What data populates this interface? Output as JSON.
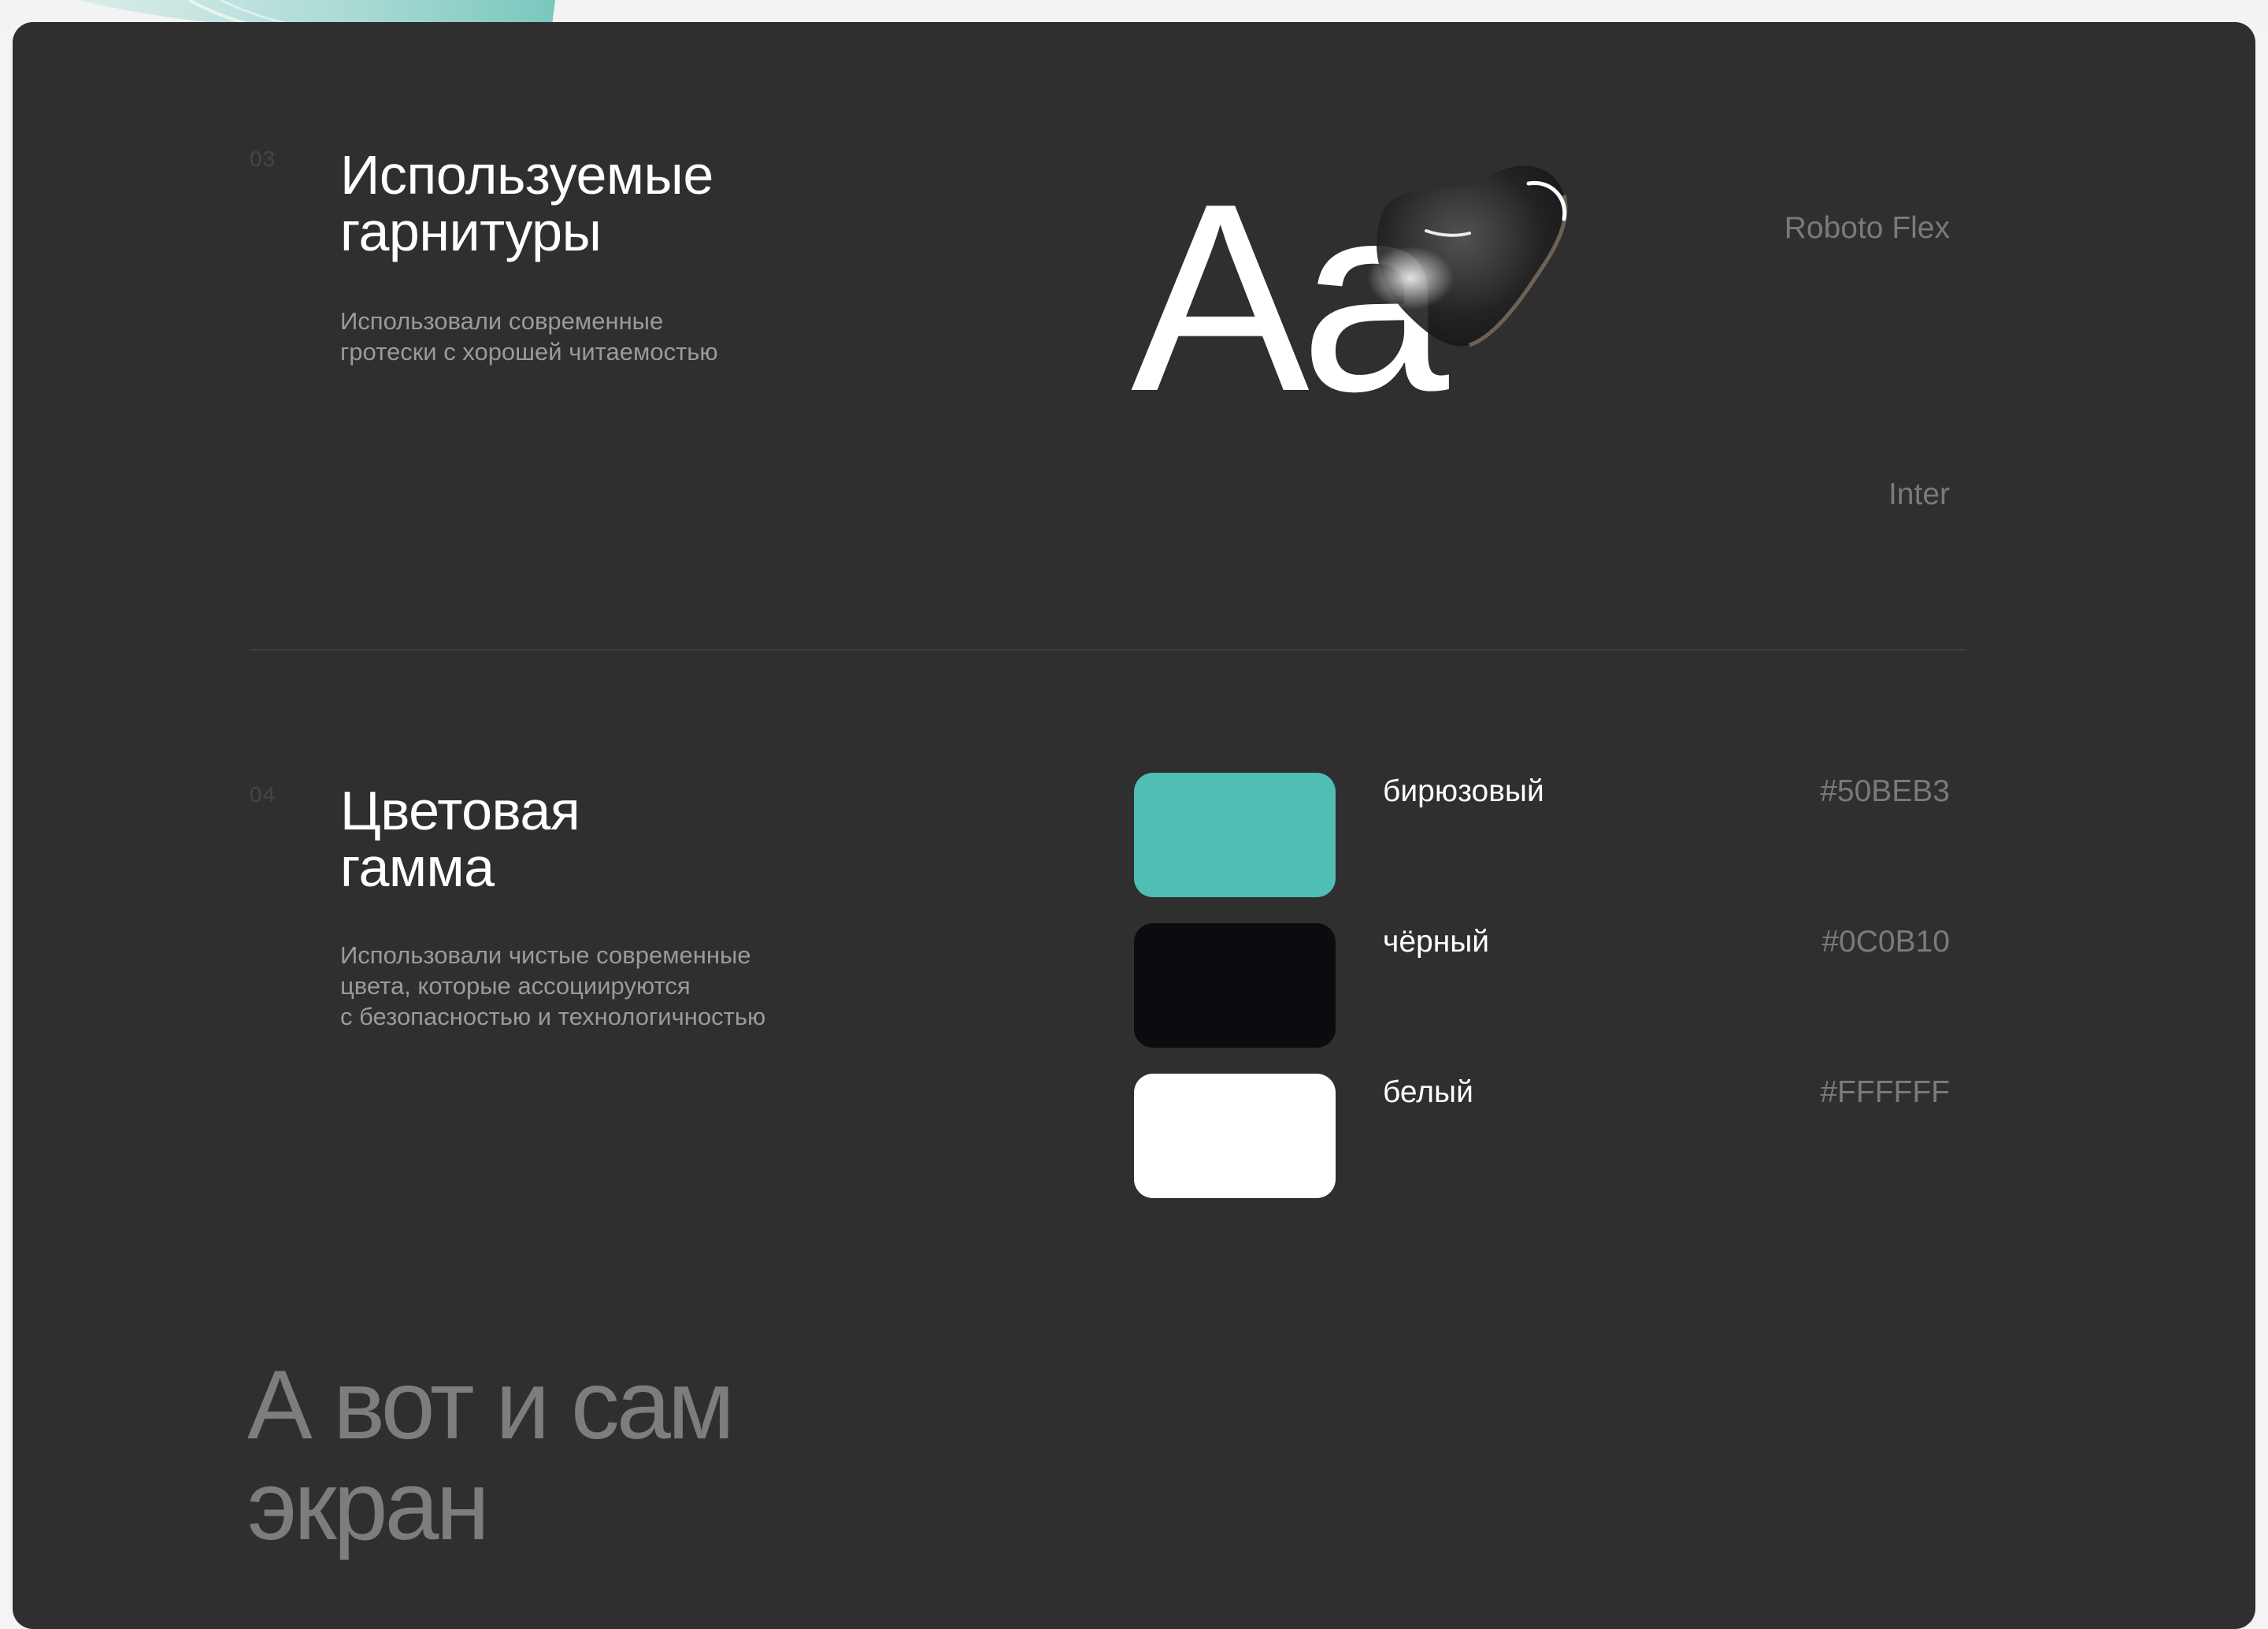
{
  "fonts_section": {
    "number": "03",
    "title_line1": "Используемые",
    "title_line2": "гарнитуры",
    "desc_line1": "Использовали современные",
    "desc_line2": "гротески с хорошей читаемостью",
    "sample": "Aa",
    "fonts": [
      "Roboto Flex",
      "Inter"
    ]
  },
  "colors_section": {
    "number": "04",
    "title_line1": "Цветовая",
    "title_line2": "гамма",
    "desc_line1": "Использовали чистые современные",
    "desc_line2": "цвета, которые ассоциируются",
    "desc_line3": "с безопасностью и технологичностью",
    "colors": [
      {
        "name": "бирюзовый",
        "hex": "#50BEB3",
        "swatch": "#50beb3"
      },
      {
        "name": "чёрный",
        "hex": "#0C0B10",
        "swatch": "#0c0b10"
      },
      {
        "name": "белый",
        "hex": "#FFFFFF",
        "swatch": "#ffffff"
      }
    ]
  },
  "screen_section": {
    "title_line1": "А вот и сам",
    "title_line2": "экран"
  },
  "theme": {
    "panel_bg": "#2f2f2f",
    "accent": "#50beb3"
  }
}
